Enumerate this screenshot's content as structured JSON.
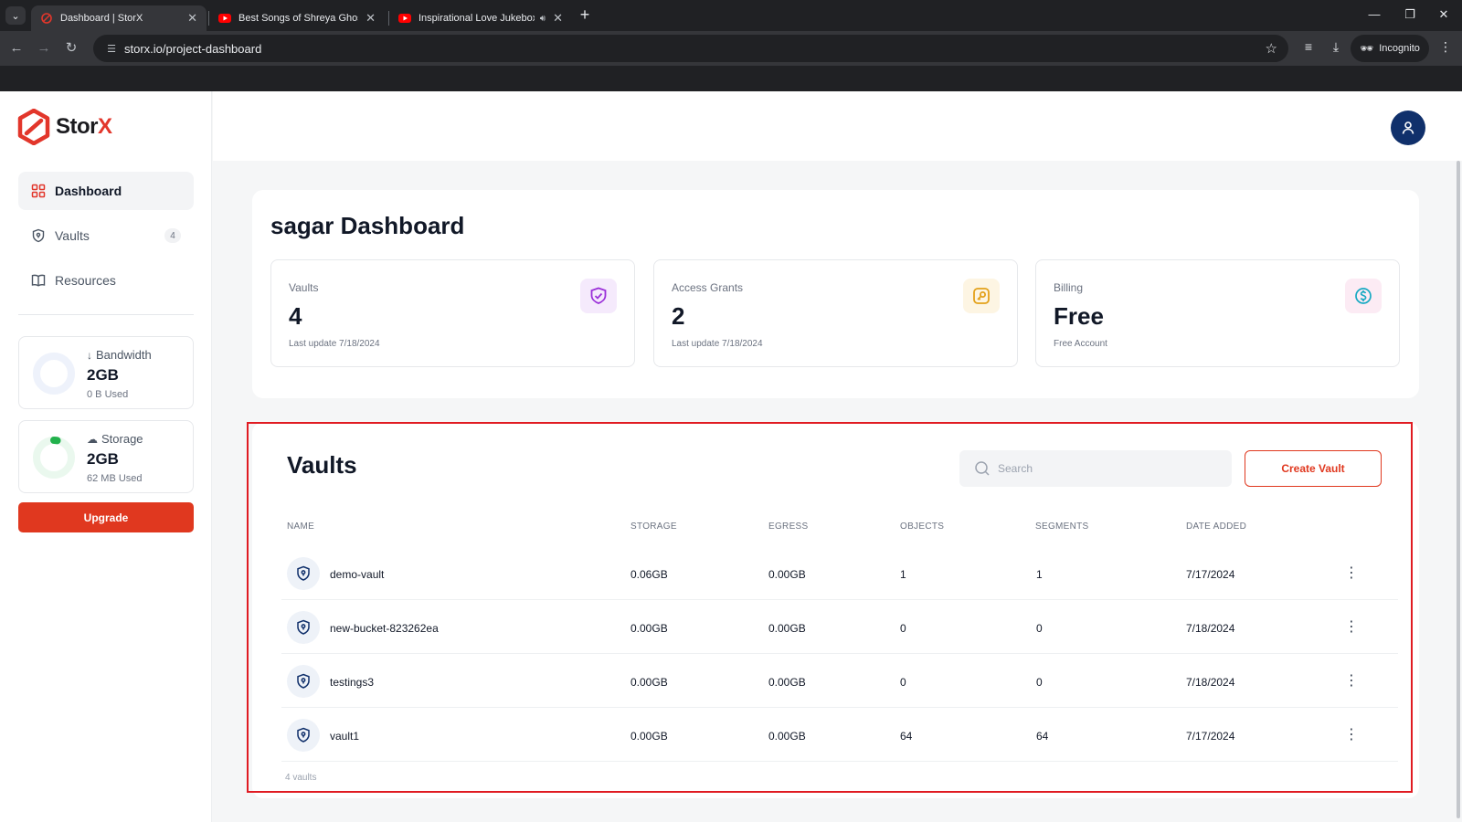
{
  "browser": {
    "tabs": [
      {
        "title": "Dashboard | StorX",
        "active": true
      },
      {
        "title": "Best Songs of Shreya Ghoshal S",
        "active": false
      },
      {
        "title": "Inspirational Love Jukebox",
        "active": false
      }
    ],
    "url": "storx.io/project-dashboard",
    "incognito_label": "Incognito"
  },
  "brand": {
    "name_main": "Stor",
    "name_accent": "X",
    "accent_color": "#e2362b"
  },
  "sidebar": {
    "nav": [
      {
        "label": "Dashboard",
        "icon": "grid-icon",
        "active": true
      },
      {
        "label": "Vaults",
        "icon": "shield-icon",
        "count": "4"
      },
      {
        "label": "Resources",
        "icon": "book-icon"
      }
    ],
    "bandwidth": {
      "label": "Bandwidth",
      "value": "2GB",
      "used": "0 B Used",
      "fraction": 0
    },
    "storage": {
      "label": "Storage",
      "value": "2GB",
      "used": "62 MB Used",
      "fraction": 0.03
    },
    "upgrade_label": "Upgrade"
  },
  "dashboard": {
    "title": "sagar Dashboard",
    "stats": [
      {
        "label": "Vaults",
        "value": "4",
        "sub": "Last update 7/18/2024",
        "icon": "shield-check-icon",
        "color": "#9b30d9"
      },
      {
        "label": "Access Grants",
        "value": "2",
        "sub": "Last update 7/18/2024",
        "icon": "key-icon",
        "color": "#e3a11a"
      },
      {
        "label": "Billing",
        "value": "Free",
        "sub": "Free Account",
        "icon": "dollar-icon",
        "color": "#17a9c2"
      }
    ]
  },
  "vaults": {
    "title": "Vaults",
    "search_placeholder": "Search",
    "create_label": "Create Vault",
    "columns": [
      "NAME",
      "STORAGE",
      "EGRESS",
      "OBJECTS",
      "SEGMENTS",
      "DATE ADDED"
    ],
    "rows": [
      {
        "name": "demo-vault",
        "storage": "0.06GB",
        "egress": "0.00GB",
        "objects": "1",
        "segments": "1",
        "date": "7/17/2024"
      },
      {
        "name": "new-bucket-823262ea",
        "storage": "0.00GB",
        "egress": "0.00GB",
        "objects": "0",
        "segments": "0",
        "date": "7/18/2024"
      },
      {
        "name": "testings3",
        "storage": "0.00GB",
        "egress": "0.00GB",
        "objects": "0",
        "segments": "0",
        "date": "7/18/2024"
      },
      {
        "name": "vault1",
        "storage": "0.00GB",
        "egress": "0.00GB",
        "objects": "64",
        "segments": "64",
        "date": "7/17/2024"
      }
    ],
    "footer": "4 vaults"
  }
}
